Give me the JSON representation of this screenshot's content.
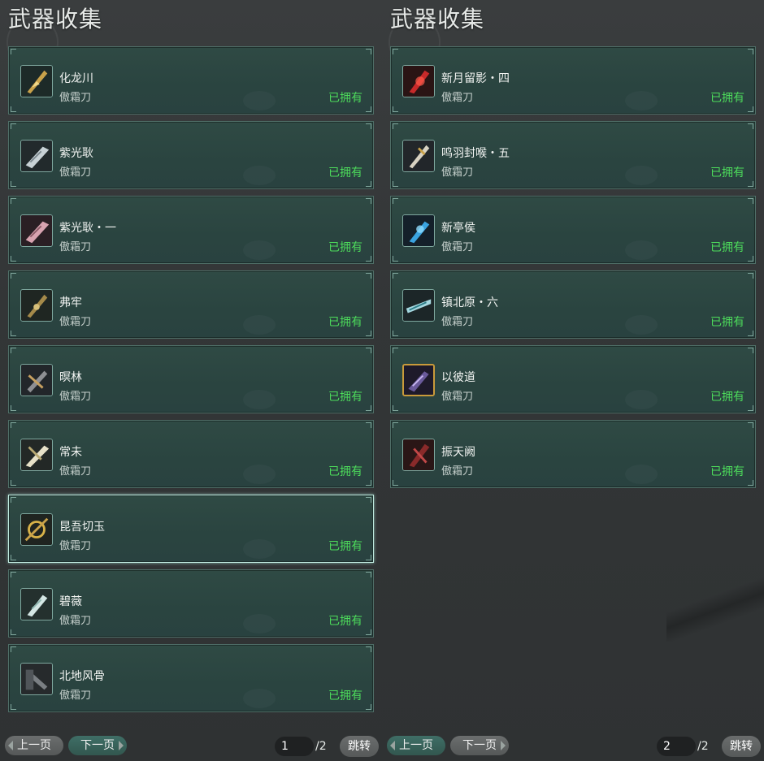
{
  "left": {
    "title": "武器收集",
    "items": [
      {
        "name": "化龙川",
        "type": "傲霜刀",
        "status": "已拥有",
        "icon": "golden-blade-icon"
      },
      {
        "name": "紫光耿",
        "type": "傲霜刀",
        "status": "已拥有",
        "icon": "silver-blade-icon"
      },
      {
        "name": "紫光耿・一",
        "type": "傲霜刀",
        "status": "已拥有",
        "icon": "pink-blade-icon"
      },
      {
        "name": "弗牢",
        "type": "傲霜刀",
        "status": "已拥有",
        "icon": "bronze-blade-icon"
      },
      {
        "name": "暝林",
        "type": "傲霜刀",
        "status": "已拥有",
        "icon": "dark-blade-icon"
      },
      {
        "name": "常未",
        "type": "傲霜刀",
        "status": "已拥有",
        "icon": "ivory-blade-icon"
      },
      {
        "name": "昆吾切玉",
        "type": "傲霜刀",
        "status": "已拥有",
        "icon": "gold-ring-blade-icon"
      },
      {
        "name": "碧薇",
        "type": "傲霜刀",
        "status": "已拥有",
        "icon": "jade-blade-icon"
      },
      {
        "name": "北地风骨",
        "type": "傲霜刀",
        "status": "已拥有",
        "icon": "iron-blade-icon"
      }
    ],
    "pager": {
      "prev": "上一页",
      "next": "下一页",
      "current": "1",
      "total": "/2",
      "jump": "跳转"
    }
  },
  "right": {
    "title": "武器收集",
    "items": [
      {
        "name": "新月留影・四",
        "type": "傲霜刀",
        "status": "已拥有",
        "icon": "crimson-blade-icon"
      },
      {
        "name": "鸣羽封喉・五",
        "type": "傲霜刀",
        "status": "已拥有",
        "icon": "feather-blade-icon"
      },
      {
        "name": "新亭侯",
        "type": "傲霜刀",
        "status": "已拥有",
        "icon": "blue-blade-icon"
      },
      {
        "name": "镇北原・六",
        "type": "傲霜刀",
        "status": "已拥有",
        "icon": "cyan-blade-icon"
      },
      {
        "name": "以彼道",
        "type": "傲霜刀",
        "status": "已拥有",
        "icon": "purple-blade-icon"
      },
      {
        "name": "振天阙",
        "type": "傲霜刀",
        "status": "已拥有",
        "icon": "red-blade-icon"
      }
    ],
    "pager": {
      "prev": "上一页",
      "next": "下一页",
      "current": "2",
      "total": "/2",
      "jump": "跳转"
    }
  },
  "selected_item": "昆吾切玉",
  "colors": {
    "owned": "#4ddc5b",
    "card": "#2c4642",
    "selected_border": "#bfe9de"
  }
}
